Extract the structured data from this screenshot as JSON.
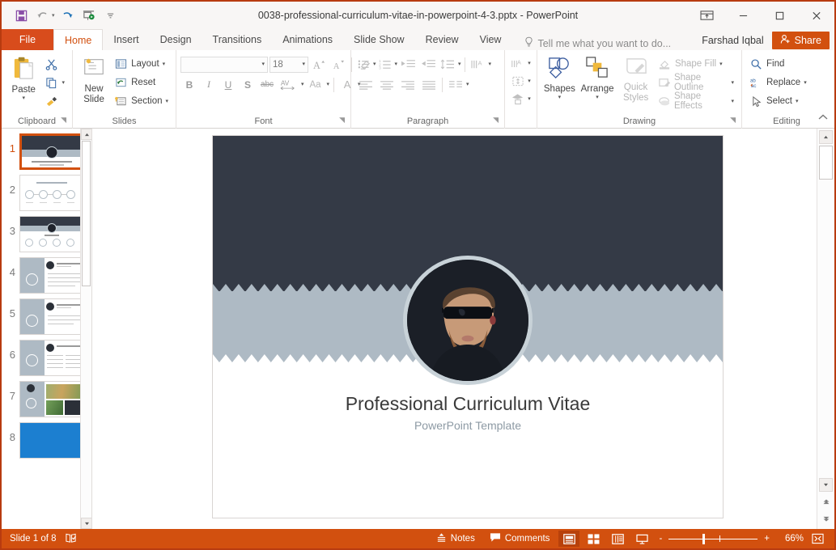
{
  "window": {
    "title": "0038-professional-curriculum-vitae-in-powerpoint-4-3.pptx - PowerPoint",
    "quick_access": [
      {
        "name": "save-icon",
        "label": "Save"
      },
      {
        "name": "undo-icon",
        "label": "Undo"
      },
      {
        "name": "redo-icon",
        "label": "Redo"
      },
      {
        "name": "start-presentation-icon",
        "label": "Start From Beginning"
      },
      {
        "name": "customize-qat-icon",
        "label": "Customize Quick Access Toolbar"
      }
    ],
    "controls": [
      {
        "name": "ribbon-display-options",
        "label": "Ribbon Display Options"
      },
      {
        "name": "minimize",
        "label": "Minimize"
      },
      {
        "name": "maximize",
        "label": "Maximize"
      },
      {
        "name": "close",
        "label": "Close"
      }
    ]
  },
  "tabs": {
    "file_label": "File",
    "items": [
      {
        "label": "Home",
        "active": true
      },
      {
        "label": "Insert",
        "active": false
      },
      {
        "label": "Design",
        "active": false
      },
      {
        "label": "Transitions",
        "active": false
      },
      {
        "label": "Animations",
        "active": false
      },
      {
        "label": "Slide Show",
        "active": false
      },
      {
        "label": "Review",
        "active": false
      },
      {
        "label": "View",
        "active": false
      }
    ],
    "tell_me": "Tell me what you want to do...",
    "user_name": "Farshad Iqbal",
    "share_label": "Share"
  },
  "ribbon": {
    "clipboard": {
      "label": "Clipboard",
      "paste_label": "Paste",
      "cut_label": "Cut",
      "copy_label": "Copy",
      "format_painter_label": "Format Painter"
    },
    "slides": {
      "label": "Slides",
      "new_slide_line1": "New",
      "new_slide_line2": "Slide",
      "layout_label": "Layout",
      "reset_label": "Reset",
      "section_label": "Section"
    },
    "font": {
      "label": "Font",
      "font_name_value": "",
      "font_size_value": "18",
      "grow_label": "A",
      "shrink_label": "A",
      "clear_formatting_label": "Clear All Formatting",
      "bold_label": "B",
      "italic_label": "I",
      "underline_label": "U",
      "shadow_label": "S",
      "strikethrough_label": "abc",
      "spacing_label": "AV",
      "case_label": "Aa",
      "font_color_label": "A"
    },
    "paragraph": {
      "label": "Paragraph",
      "bullets_label": "Bullets",
      "numbering_label": "Numbering",
      "decrease_indent_label": "Decrease Indent",
      "increase_indent_label": "Increase Indent",
      "line_spacing_label": "Line Spacing",
      "text_direction_label": "Text Direction",
      "align_text_label": "Align Text",
      "smartart_label": "Convert to SmartArt",
      "align_left_label": "Align Left",
      "align_center_label": "Center",
      "align_right_label": "Align Right",
      "justify_label": "Justify",
      "columns_label": "Columns"
    },
    "drawing": {
      "label": "Drawing",
      "shapes_label": "Shapes",
      "arrange_label": "Arrange",
      "quick_styles_line1": "Quick",
      "quick_styles_line2": "Styles",
      "shape_fill_label": "Shape Fill",
      "shape_outline_label": "Shape Outline",
      "shape_effects_label": "Shape Effects"
    },
    "editing": {
      "label": "Editing",
      "find_label": "Find",
      "replace_label": "Replace",
      "select_label": "Select",
      "collapse_label": "Collapse the Ribbon"
    }
  },
  "thumbnails": [
    {
      "number": "1",
      "selected": true,
      "kind": "cover"
    },
    {
      "number": "2",
      "selected": false,
      "kind": "process"
    },
    {
      "number": "3",
      "selected": false,
      "kind": "cover-icons"
    },
    {
      "number": "4",
      "selected": false,
      "kind": "sidebar-list"
    },
    {
      "number": "5",
      "selected": false,
      "kind": "sidebar-list"
    },
    {
      "number": "6",
      "selected": false,
      "kind": "sidebar-grid"
    },
    {
      "number": "7",
      "selected": false,
      "kind": "photo-grid"
    },
    {
      "number": "8",
      "selected": false,
      "kind": "blue"
    }
  ],
  "slide": {
    "title": "Professional Curriculum Vitae",
    "subtitle": "PowerPoint Template",
    "colors": {
      "dark_band": "#343a46",
      "gray_band": "#aebac4",
      "photo_ring": "#c8d2d8",
      "title_color": "#3a3a3a",
      "subtitle_color": "#8d9aa4"
    }
  },
  "status": {
    "slide_indicator": "Slide 1 of 8",
    "spellcheck_label": "Spell Check",
    "notes_label": "Notes",
    "comments_label": "Comments",
    "views": [
      {
        "name": "normal-view",
        "active": true
      },
      {
        "name": "slide-sorter-view",
        "active": false
      },
      {
        "name": "reading-view",
        "active": false
      },
      {
        "name": "slide-show-view",
        "active": false
      }
    ],
    "zoom_out_label": "-",
    "zoom_in_label": "+",
    "zoom_level": "66%",
    "fit_label": "Fit slide to current window"
  },
  "theme": {
    "accent": "#d2500f",
    "ribbon_red": "#d84c1c"
  }
}
